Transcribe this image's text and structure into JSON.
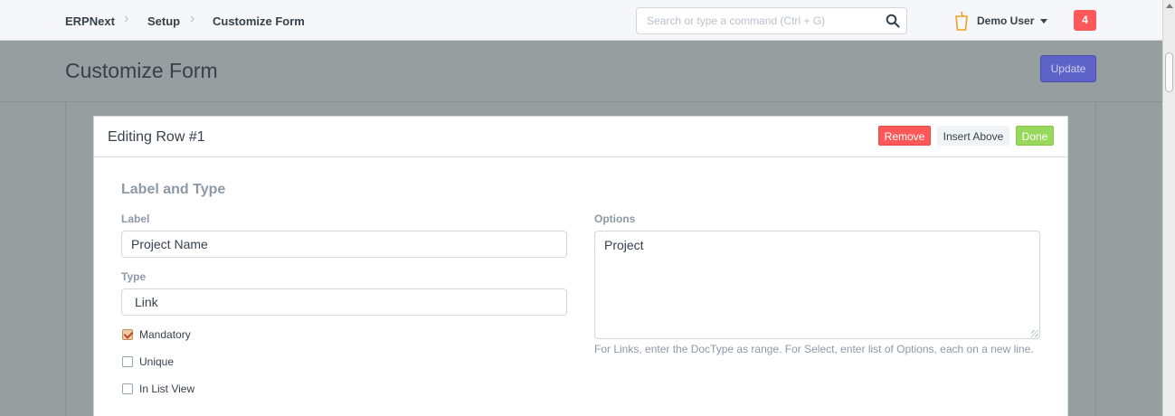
{
  "breadcrumb": [
    "ERPNext",
    "Setup",
    "Customize Form"
  ],
  "search": {
    "placeholder": "Search or type a command (Ctrl + G)"
  },
  "user": {
    "name": "Demo User",
    "notification_count": "4"
  },
  "page": {
    "title": "Customize Form",
    "update_label": "Update"
  },
  "dialog": {
    "title": "Editing Row #1",
    "remove_label": "Remove",
    "insert_above_label": "Insert Above",
    "done_label": "Done",
    "section_title": "Label and Type",
    "label_field": {
      "label": "Label",
      "value": "Project Name"
    },
    "type_field": {
      "label": "Type",
      "value": "Link"
    },
    "options_field": {
      "label": "Options",
      "value": "Project",
      "help": "For Links, enter the DocType as range. For Select, enter list of Options, each on a new line."
    },
    "checkboxes": [
      {
        "label": "Mandatory",
        "checked": true
      },
      {
        "label": "Unique",
        "checked": false
      },
      {
        "label": "In List View",
        "checked": false
      }
    ]
  },
  "colors": {
    "primary": "#5e64c7",
    "danger": "#ff5858",
    "success": "#98d85b",
    "muted": "#8d99a6"
  }
}
